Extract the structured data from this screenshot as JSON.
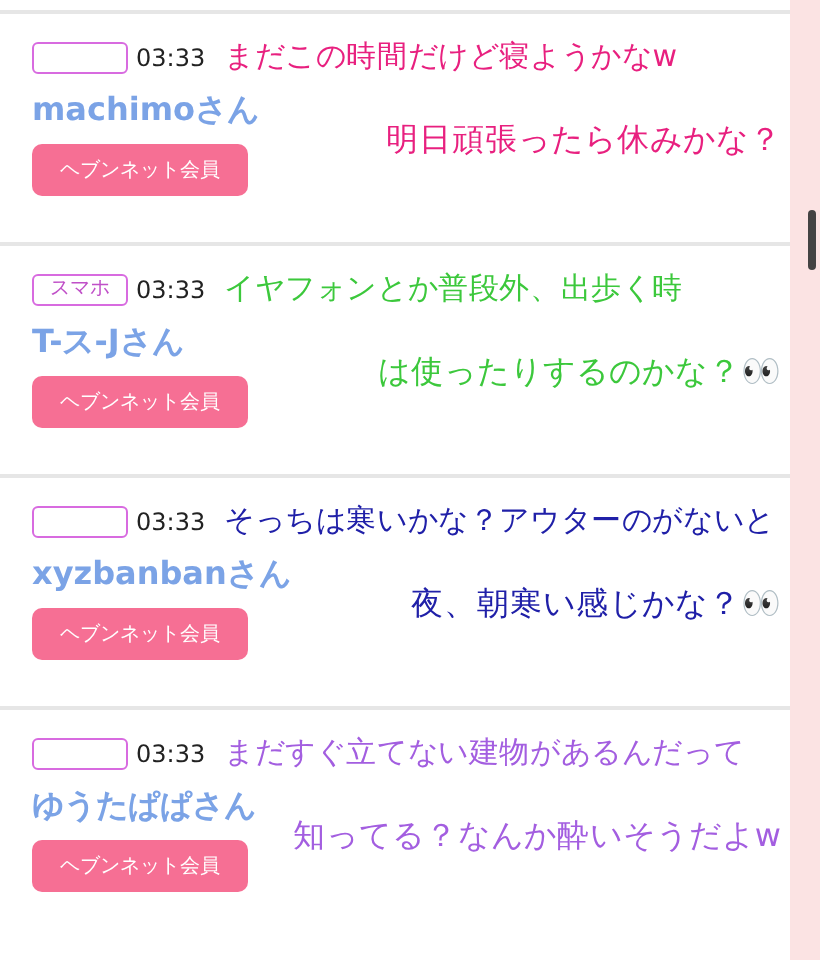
{
  "posts": [
    {
      "time": "03:33",
      "name": "machimoさん",
      "badge": "ヘブンネット会員",
      "caption": [
        "まだこの時間だけど寝ようかなw",
        "明日頑張ったら休みかな？"
      ],
      "color": "#e8207f"
    },
    {
      "tag": "スマホ",
      "time": "03:33",
      "name": "T-ス-Jさん",
      "badge": "ヘブンネット会員",
      "caption": [
        "イヤフォンとか普段外、出歩く時",
        "は使ったりするのかな？👀"
      ],
      "color": "#3cc83c"
    },
    {
      "time": "03:33",
      "name": "xyzbanbanさん",
      "badge": "ヘブンネット会員",
      "caption": [
        "そっちは寒いかな？アウターのがないと",
        "夜、朝寒い感じかな？👀"
      ],
      "color": "#2020a8"
    },
    {
      "time": "03:33",
      "name": "ゆうたぱぱさん",
      "badge": "ヘブンネット会員",
      "caption": [
        "まだすぐ立てない建物があるんだって",
        "知ってる？なんか酔いそうだよw"
      ],
      "color": "#a35ee0"
    }
  ]
}
